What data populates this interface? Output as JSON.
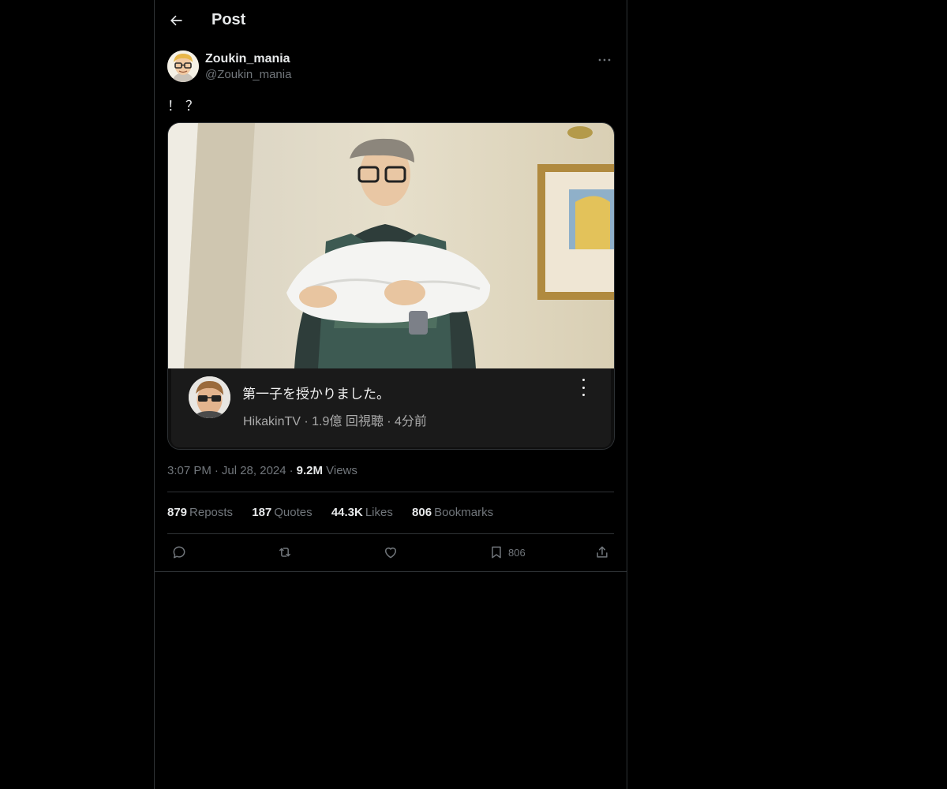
{
  "header": {
    "title": "Post"
  },
  "author": {
    "display_name": "Zoukin_mania",
    "handle": "@Zoukin_mania"
  },
  "tweet": {
    "text": "！？"
  },
  "media": {
    "video_title": "第一子を授かりました。",
    "channel_meta": "HikakinTV · 1.9億 回視聴 · 4分前"
  },
  "meta": {
    "time": "3:07 PM",
    "date": "Jul 28, 2024",
    "views_count": "9.2M",
    "views_label": "Views",
    "separator": "·"
  },
  "stats": [
    {
      "count": "879",
      "label": "Reposts"
    },
    {
      "count": "187",
      "label": "Quotes"
    },
    {
      "count": "44.3K",
      "label": "Likes"
    },
    {
      "count": "806",
      "label": "Bookmarks"
    }
  ],
  "actions": {
    "reply_icon": "reply-icon",
    "repost_icon": "repost-icon",
    "like_icon": "heart-icon",
    "bookmark_icon": "bookmark-icon",
    "bookmark_count": "806",
    "share_icon": "share-icon"
  },
  "colors": {
    "background": "#000000",
    "text": "#e7e9ea",
    "muted": "#71767b",
    "border": "#2f3336"
  }
}
